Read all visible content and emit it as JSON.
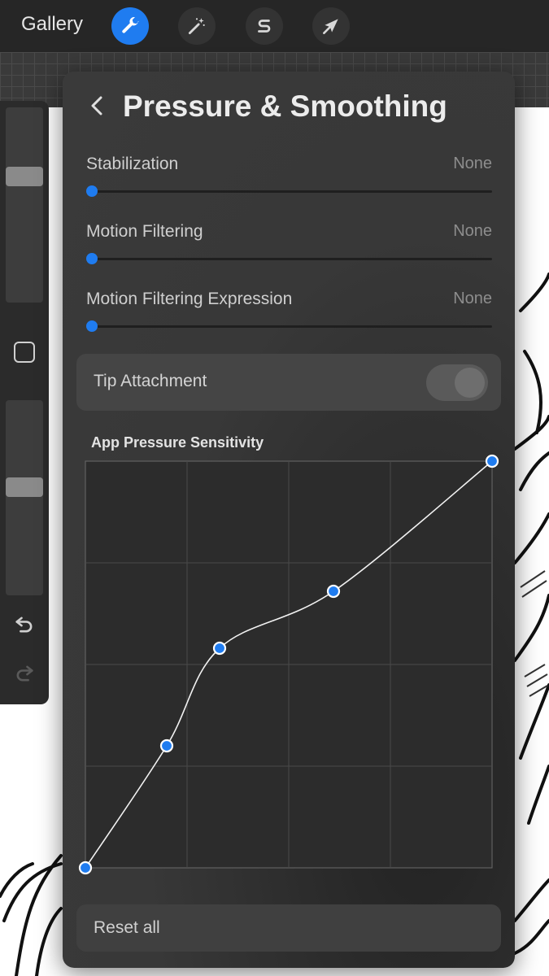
{
  "toolbar": {
    "gallery_label": "Gallery",
    "tools": [
      {
        "icon": "wrench-icon",
        "active": true
      },
      {
        "icon": "magic-wand-icon",
        "active": false
      },
      {
        "icon": "selection-s-icon",
        "active": false
      },
      {
        "icon": "transform-arrow-icon",
        "active": false
      }
    ],
    "accent": "#1f7cf0"
  },
  "sidebar": {
    "brush_size_level": 0.66,
    "opacity_level": 0.56,
    "icons": [
      "modifier-square-icon",
      "undo-icon",
      "redo-icon"
    ]
  },
  "panel": {
    "title": "Pressure & Smoothing",
    "sliders": [
      {
        "label": "Stabilization",
        "value": "None",
        "level": 0
      },
      {
        "label": "Motion Filtering",
        "value": "None",
        "level": 0
      },
      {
        "label": "Motion Filtering Expression",
        "value": "None",
        "level": 0
      }
    ],
    "tip_attachment": {
      "label": "Tip Attachment",
      "enabled": false
    },
    "pressure_curve": {
      "title": "App Pressure Sensitivity",
      "grid_divisions": 4,
      "points": [
        [
          0,
          0
        ],
        [
          0.2,
          0.3
        ],
        [
          0.33,
          0.54
        ],
        [
          0.61,
          0.68
        ],
        [
          1,
          1
        ]
      ]
    },
    "reset_label": "Reset all"
  }
}
